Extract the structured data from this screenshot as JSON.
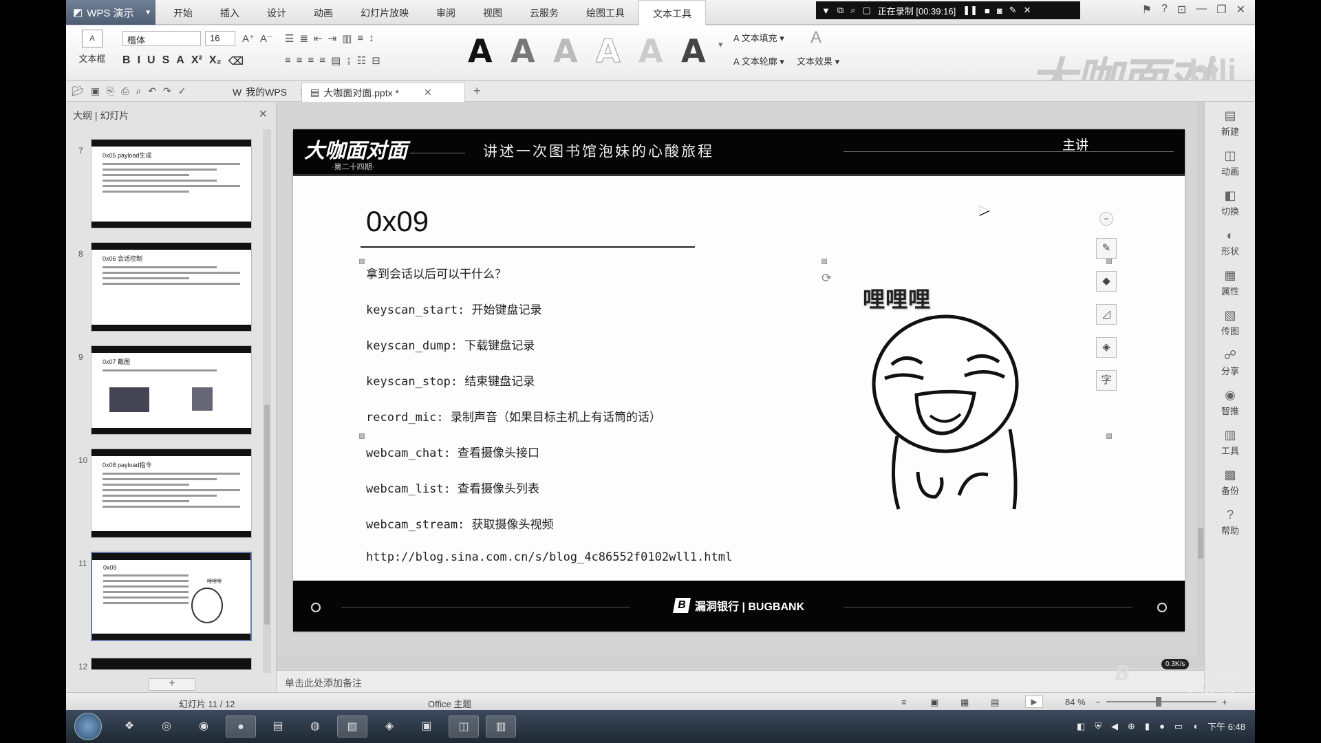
{
  "app": {
    "name": "WPS 演示"
  },
  "menu": [
    "开始",
    "插入",
    "设计",
    "动画",
    "幻灯片放映",
    "审阅",
    "视图",
    "云服务",
    "绘图工具",
    "文本工具"
  ],
  "menu_active_index": 9,
  "recording": {
    "label": "正在录制 [00:39:16]"
  },
  "ribbon": {
    "textbox_label": "文本框",
    "font_name": "楷体",
    "font_size": "16",
    "format_buttons": [
      "B",
      "I",
      "U",
      "S",
      "A",
      "X²",
      "X₂"
    ],
    "text_fill": "文本填充",
    "text_outline": "文本轮廓",
    "text_effect": "文本效果",
    "style_glyph": "A"
  },
  "watermark": {
    "brand": "大咖面对面",
    "site": "bili"
  },
  "tabs": {
    "home": "我的WPS",
    "doc": "大咖面对面.pptx *"
  },
  "left_panel": {
    "header": "大纲 | 幻灯片",
    "slides": [
      {
        "num": "7",
        "title": "0x05 payload生成"
      },
      {
        "num": "8",
        "title": "0x06 会话控制"
      },
      {
        "num": "9",
        "title": "0x07 截图"
      },
      {
        "num": "10",
        "title": "0x08 payload指令"
      },
      {
        "num": "11",
        "title": "0x09",
        "meme": "哩哩哩"
      },
      {
        "num": "12",
        "title": ""
      }
    ],
    "add_label": "+"
  },
  "slide": {
    "logo": "大咖面对面",
    "issue": "·第二十四期·",
    "subtitle": "讲述一次图书馆泡妹的心酸旅程",
    "host": "主讲",
    "title": "0x09",
    "lines": [
      "拿到会话以后可以干什么？",
      "keyscan_start: 开始键盘记录",
      "keyscan_dump: 下载键盘记录",
      "keyscan_stop: 结束键盘记录",
      "record_mic: 录制声音（如果目标主机上有话筒的话）",
      "webcam_chat: 查看摄像头接口",
      "webcam_list: 查看摄像头列表",
      "webcam_stream: 获取摄像头视频",
      "http://blog.sina.com.cn/s/blog_4c86552f0102wll1.html"
    ],
    "meme_text": "哩哩哩",
    "footer_brand": "漏洞银行 | BUGBANK",
    "footer_logo": "B"
  },
  "notes_placeholder": "单击此处添加备注",
  "right_bar": [
    "新建",
    "动画",
    "切换",
    "形状",
    "属性",
    "传图",
    "分享",
    "智推",
    "工具",
    "备份",
    "帮助"
  ],
  "status": {
    "slide_counter": "幻灯片 11 / 12",
    "theme": "Office 主题",
    "zoom": "84 %"
  },
  "taskbar": {
    "time": "下午 6:48"
  },
  "overlay": {
    "net_speed": "0.3K/s",
    "bank_cn": "漏洞银行",
    "bank_en": "BUGBANK"
  }
}
